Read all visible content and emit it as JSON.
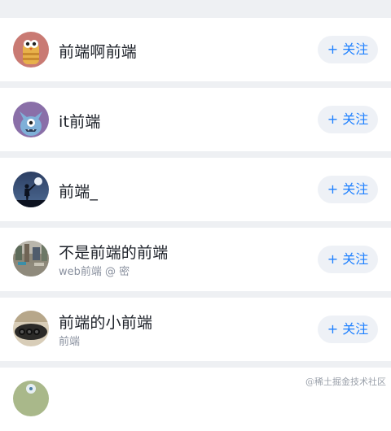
{
  "follow_label": "关注",
  "plus_glyph": "+",
  "users": [
    {
      "name": "前端啊前端",
      "subtitle": "",
      "avatar_icon": "owl-cartoon-avatar",
      "avatar_color": "#c97a73"
    },
    {
      "name": "it前端",
      "subtitle": "",
      "avatar_icon": "blue-monster-avatar",
      "avatar_color": "#8a6fa8"
    },
    {
      "name": "前端_",
      "subtitle": "",
      "avatar_icon": "night-silhouette-avatar",
      "avatar_color": "#1e2b44"
    },
    {
      "name": "不是前端的前端",
      "subtitle": "web前端 @ 密",
      "avatar_icon": "street-photo-avatar",
      "avatar_color": "#7a7466"
    },
    {
      "name": "前端的小前端",
      "subtitle": "前端",
      "avatar_icon": "binoculars-photo-avatar",
      "avatar_color": "#3a3835"
    },
    {
      "name": "",
      "subtitle": "",
      "avatar_icon": "green-cartoon-avatar",
      "avatar_color": "#a9b88a"
    }
  ],
  "watermark": "@稀土掘金技术社区",
  "colors": {
    "accent": "#1e80ff",
    "button_bg": "#eef1f6",
    "page_bg": "#eef0f3"
  }
}
